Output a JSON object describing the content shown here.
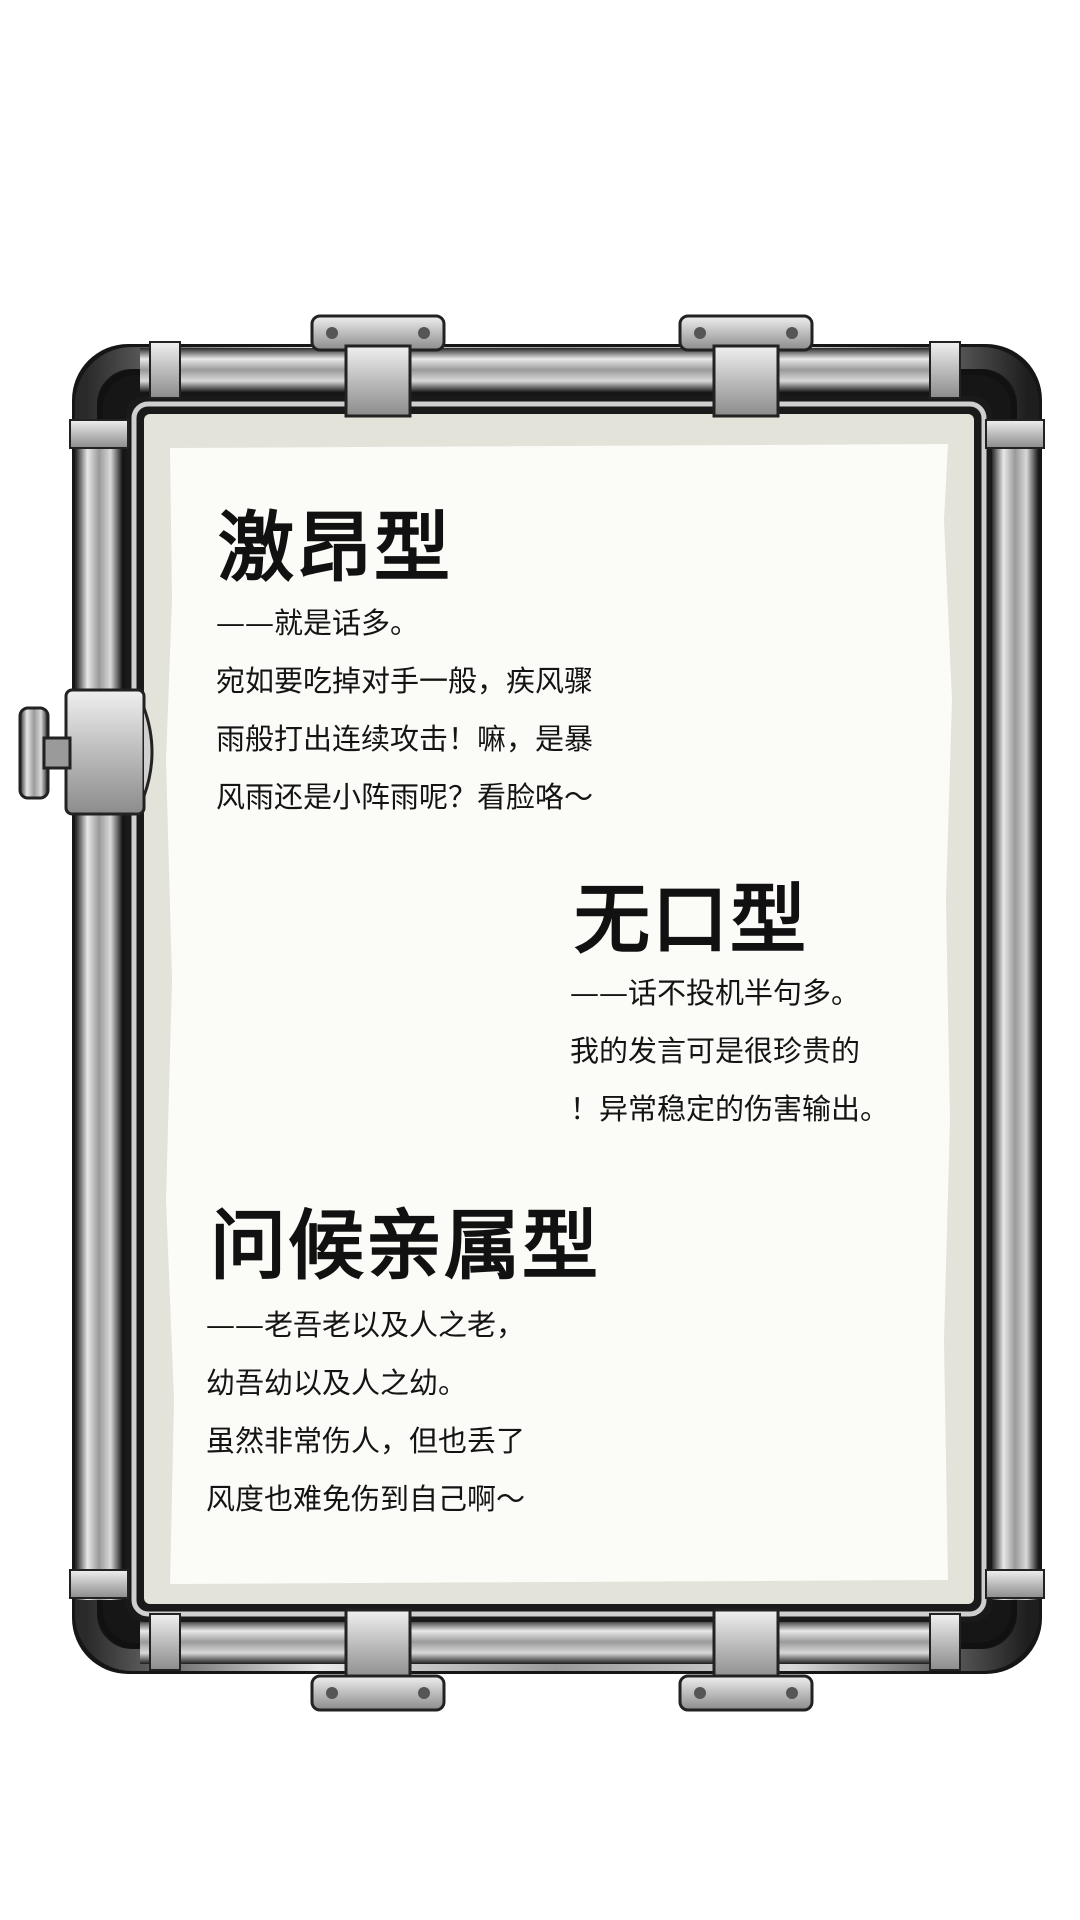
{
  "sections": [
    {
      "title": "激昂型",
      "lines": [
        "——就是话多。",
        "宛如要吃掉对手一般，疾风骤",
        "雨般打出连续攻击！嘛，是暴",
        "风雨还是小阵雨呢？看脸咯～"
      ]
    },
    {
      "title": "无口型",
      "lines": [
        "——话不投机半句多。",
        "我的发言可是很珍贵的",
        "！异常稳定的伤害输出。"
      ]
    },
    {
      "title": "问候亲属型",
      "lines": [
        "——老吾老以及人之老，",
        "幼吾幼以及人之幼。",
        "虽然非常伤人，但也丢了",
        "风度也难免伤到自己啊～"
      ]
    }
  ],
  "colors": {
    "paper": "#fbfbf8",
    "paper_border": "#e3e3da",
    "pipe_dark": "#1c1c1c",
    "pipe_light": "#d4d4d4",
    "bracket": "#bdbdbd"
  },
  "icons": [
    "latch-knob-icon",
    "hinge-bracket-icon"
  ]
}
